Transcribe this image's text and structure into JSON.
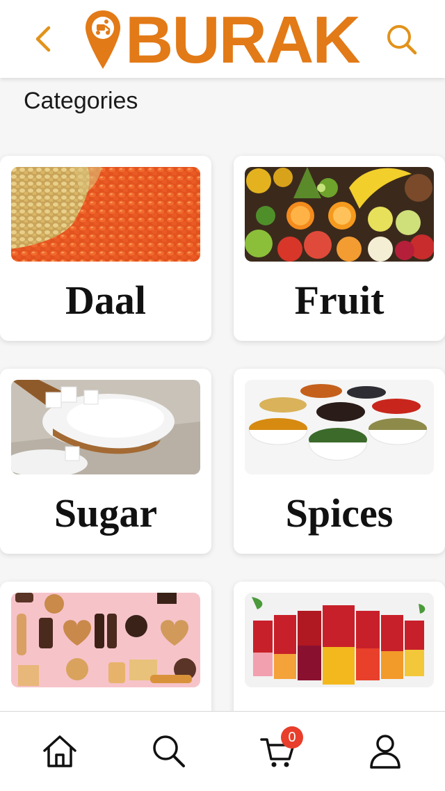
{
  "header": {
    "logo_text": "BURAK",
    "brand_color": "#e27a17",
    "back_icon": "chevron-left-icon",
    "search_icon": "search-icon"
  },
  "page": {
    "title": "Categories"
  },
  "categories": [
    {
      "label": "Daal"
    },
    {
      "label": "Fruit"
    },
    {
      "label": "Sugar"
    },
    {
      "label": "Spices"
    },
    {
      "label": ""
    },
    {
      "label": ""
    }
  ],
  "bottom_nav": {
    "items": [
      "home-icon",
      "search-icon",
      "cart-icon",
      "profile-icon"
    ],
    "cart_badge": "0",
    "badge_color": "#e83e2b"
  }
}
